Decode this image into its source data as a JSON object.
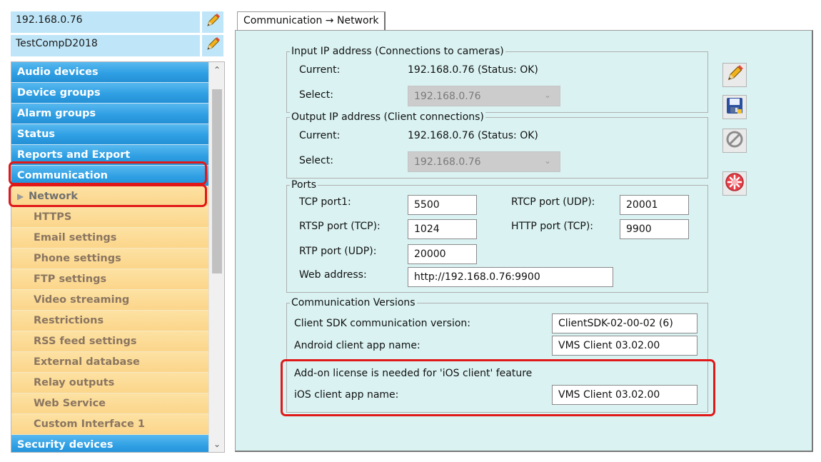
{
  "header": {
    "ip_value": "192.168.0.76",
    "computer_value": "TestCompD2018"
  },
  "nav": {
    "items": [
      {
        "label": "Audio devices",
        "kind": "group"
      },
      {
        "label": "Device groups",
        "kind": "group"
      },
      {
        "label": "Alarm groups",
        "kind": "group"
      },
      {
        "label": "Status",
        "kind": "group"
      },
      {
        "label": "Reports and Export",
        "kind": "group"
      },
      {
        "label": "Communication",
        "kind": "group"
      },
      {
        "label": "Network",
        "kind": "sub",
        "selected": true
      },
      {
        "label": "HTTPS",
        "kind": "sub"
      },
      {
        "label": "Email settings",
        "kind": "sub"
      },
      {
        "label": "Phone settings",
        "kind": "sub"
      },
      {
        "label": "FTP settings",
        "kind": "sub"
      },
      {
        "label": "Video streaming",
        "kind": "sub"
      },
      {
        "label": "Restrictions",
        "kind": "sub"
      },
      {
        "label": "RSS feed settings",
        "kind": "sub"
      },
      {
        "label": "External database",
        "kind": "sub"
      },
      {
        "label": "Relay outputs",
        "kind": "sub"
      },
      {
        "label": "Web Service",
        "kind": "sub"
      },
      {
        "label": "Custom Interface 1",
        "kind": "sub"
      },
      {
        "label": "Security devices",
        "kind": "group"
      }
    ]
  },
  "tab": {
    "label": "Communication → Network"
  },
  "input_ip": {
    "legend": "Input IP address (Connections to cameras)",
    "current_label": "Current:",
    "current_value": "192.168.0.76 (Status: OK)",
    "select_label": "Select:",
    "select_value": "192.168.0.76"
  },
  "output_ip": {
    "legend": "Output IP address (Client connections)",
    "current_label": "Current:",
    "current_value": "192.168.0.76 (Status: OK)",
    "select_label": "Select:",
    "select_value": "192.168.0.76"
  },
  "ports": {
    "legend": "Ports",
    "tcp_port1_label": "TCP port1:",
    "tcp_port1_value": "5500",
    "rtcp_label": "RTCP port (UDP):",
    "rtcp_value": "20001",
    "rtsp_label": "RTSP port (TCP):",
    "rtsp_value": "1024",
    "http_label": "HTTP port (TCP):",
    "http_value": "9900",
    "rtp_label": "RTP port (UDP):",
    "rtp_value": "20000",
    "web_label": "Web address:",
    "web_value": "http://192.168.0.76:9900"
  },
  "versions": {
    "legend": "Communication Versions",
    "sdk_label": "Client SDK communication version:",
    "sdk_value": "ClientSDK-02-00-02 (6)",
    "android_label": "Android client app name:",
    "android_value": "VMS Client 03.02.00",
    "ios_notice": "Add-on license is needed for 'iOS client' feature",
    "ios_label": "iOS client app name:",
    "ios_value": "VMS Client 03.02.00"
  },
  "toolbar": {
    "icons": [
      "pencil-icon",
      "save-icon",
      "cancel-icon",
      "reset-icon"
    ]
  },
  "colors": {
    "nav_blue": "#2f9fe3",
    "nav_sub": "#fbd58a",
    "panel_bg": "#daf2f2",
    "highlight_red": "#e11818"
  }
}
